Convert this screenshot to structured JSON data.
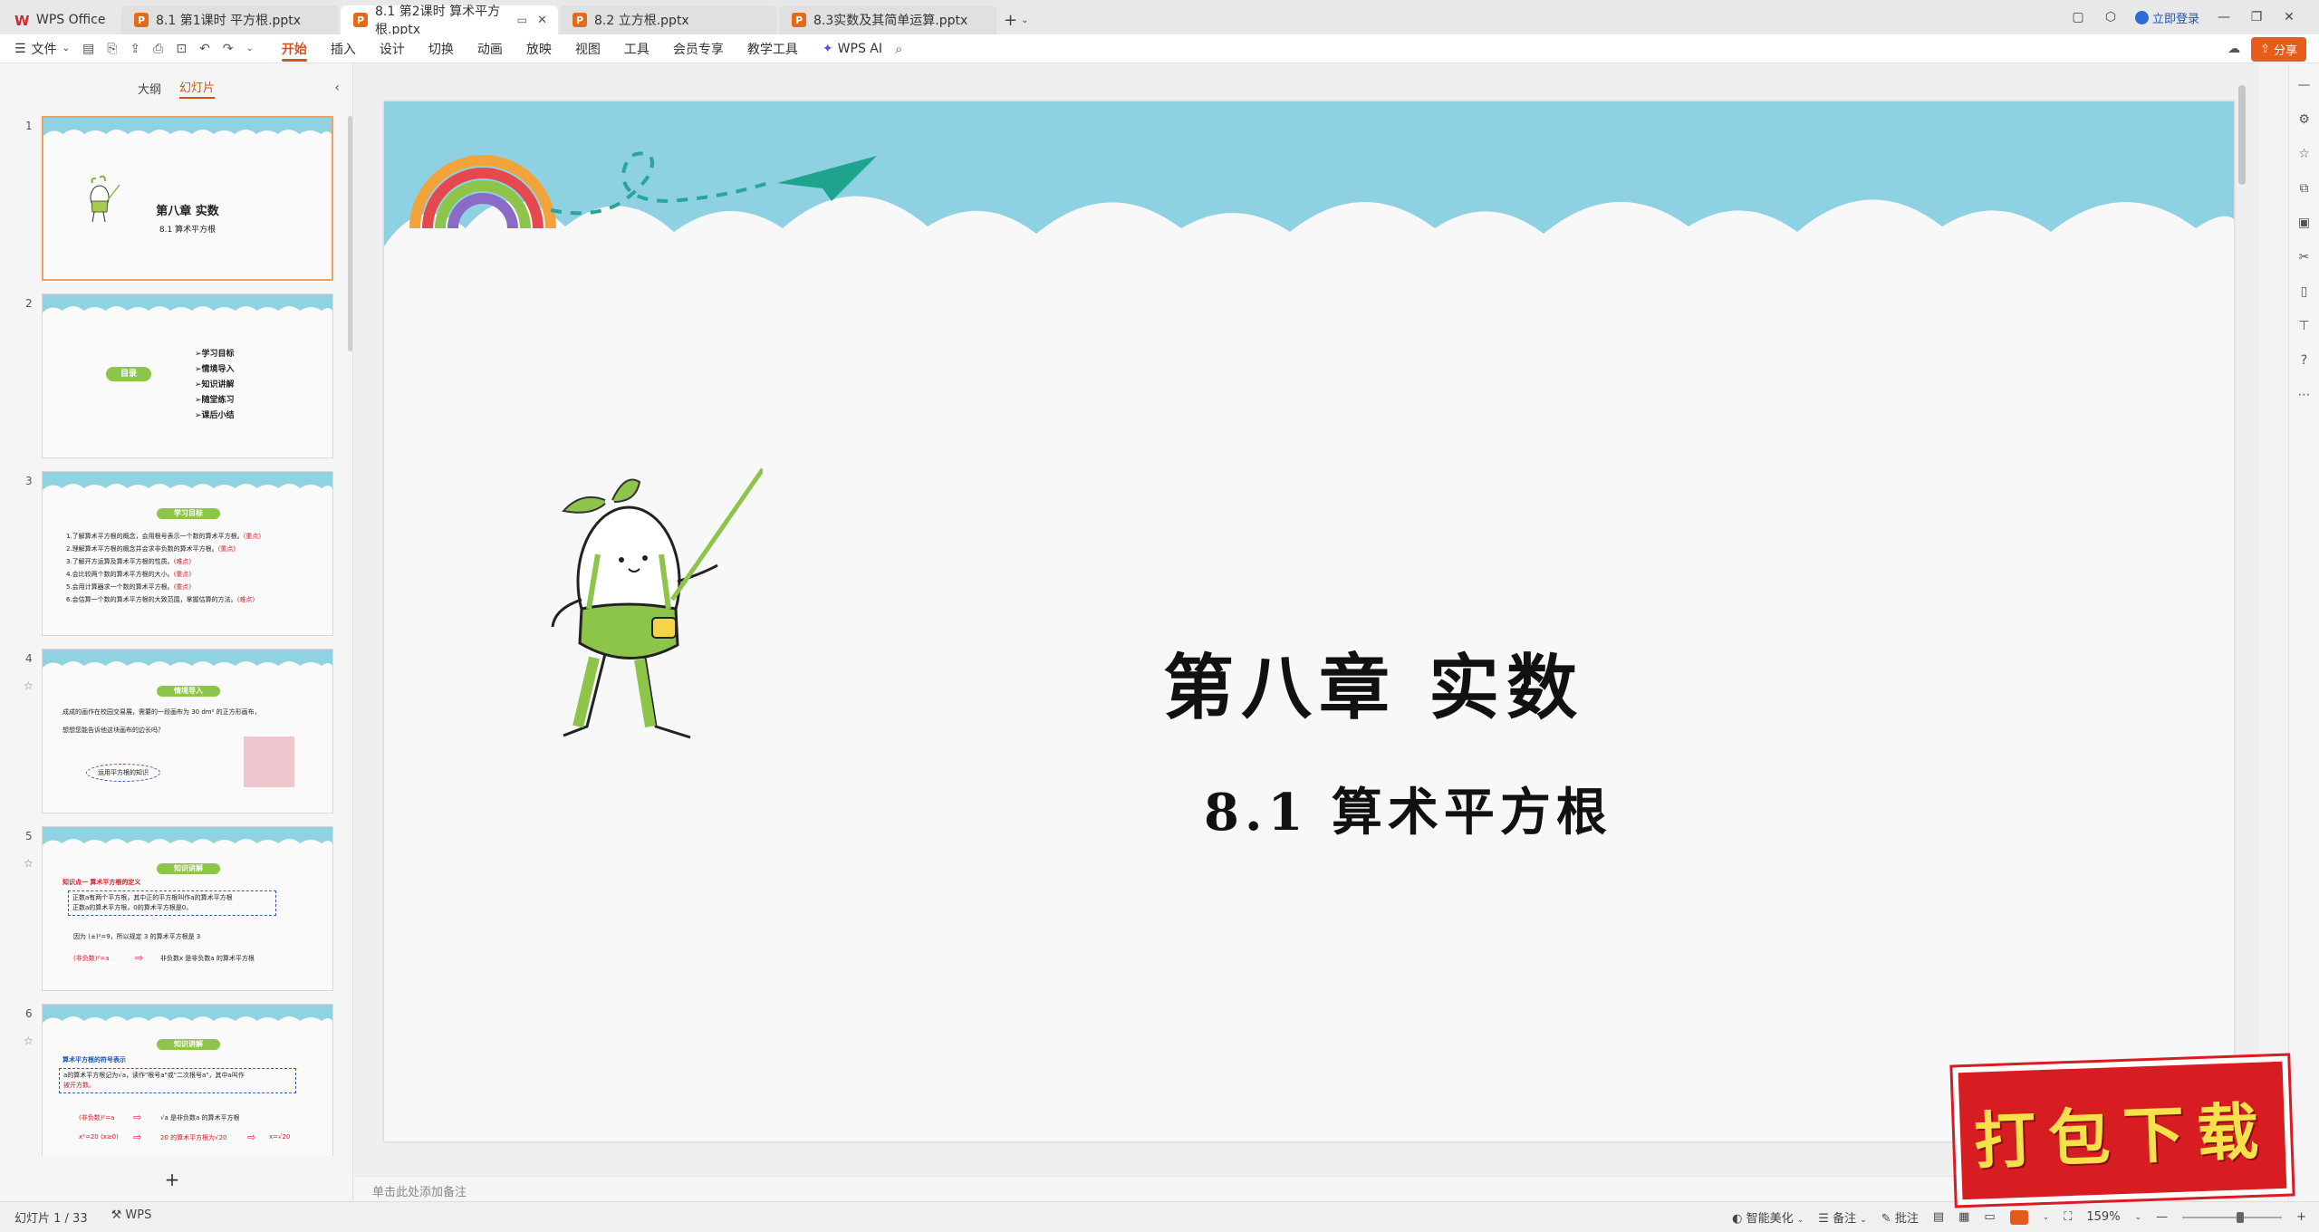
{
  "tabs": {
    "home": "WPS Office",
    "docs": [
      {
        "label": "8.1 第1课时 平方根.pptx",
        "active": false
      },
      {
        "label": "8.1 第2课时 算术平方根.pptx",
        "active": true
      },
      {
        "label": "8.2 立方根.pptx",
        "active": false
      },
      {
        "label": "8.3实数及其简单运算.pptx",
        "active": false
      }
    ],
    "add": "+",
    "login": "立即登录"
  },
  "ribbon": {
    "file": "文件",
    "menus": [
      "开始",
      "插入",
      "设计",
      "切换",
      "动画",
      "放映",
      "视图",
      "工具",
      "会员专享",
      "教学工具"
    ],
    "active_menu": "开始",
    "wps_ai": "WPS AI",
    "share": "分享"
  },
  "panel": {
    "outline_tab": "大纲",
    "slides_tab": "幻灯片",
    "add": "+"
  },
  "thumbs": {
    "s1": {
      "num": "1",
      "title": "第八章 实数",
      "sub": "8.1 算术平方根"
    },
    "s2": {
      "num": "2",
      "pill": "目录",
      "toc": [
        "➢学习目标",
        "➢情境导入",
        "➢知识讲解",
        "➢随堂练习",
        "➢课后小结"
      ]
    },
    "s3": {
      "num": "3",
      "pill": "学习目标",
      "lines": [
        "1.了解算术平方根的概念，会用根号表示一个数的算术平方根。",
        "2.理解算术平方根的概念并会求非负数的算术平方根。",
        "3.了解开方运算及算术平方根的性质。",
        "4.会比较两个数的算术平方根的大小。",
        "5.会用计算器求一个数的算术平方根。",
        "6.会估算一个数的算术平方根的大致范围，掌握估算的方法。"
      ],
      "marks": [
        "(重点)",
        "(重点)",
        "(难点)",
        "(重点)",
        "(重点)",
        "(难点)"
      ]
    },
    "s4": {
      "num": "4",
      "pill": "情境导入",
      "line1": "成成的画作在校园交易展，需要的一段画布为 30 dm² 的正方形画布，",
      "line2": "想想您能告诉他这块画布的边长吗？",
      "oval": "运用平方根的知识"
    },
    "s5": {
      "num": "5",
      "pill": "知识讲解",
      "heading": "知识点一  算术平方根的定义",
      "def1": "正数a有两个平方根，其中正的平方根叫作a的算术平方根",
      "def2": "正数a的算术平方根，0的算术平方根是0。",
      "line1": "因为 (±)²=9，所以规定 3 的算术平方根是 3",
      "left": "(非负数)²=a",
      "right": "非负数x 是非负数a 的算术平方根"
    },
    "s6": {
      "num": "6",
      "pill": "知识讲解",
      "heading": "算术平方根的符号表示",
      "box1": "a的算术平方根记为√a，读作\"根号a\"或\"二次根号a\"，其中a叫作",
      "box2": "被开方数。",
      "row1l": "(非负数)²=a",
      "row1r": "√a 是非负数a 的算术平方根",
      "row2l": "x²=20 (x≥0)",
      "row2m": "20 的算术平方根为√20",
      "row2r": "x=√20"
    }
  },
  "slide": {
    "title": "第八章  实数",
    "subtitle": "8.1  算术平方根"
  },
  "notes": {
    "placeholder": "单击此处添加备注"
  },
  "status": {
    "slide_info": "幻灯片 1 / 33",
    "app": "WPS",
    "smart": "智能美化",
    "notes_btn": "备注",
    "comment_btn": "批注",
    "zoom": "159%"
  },
  "banner": {
    "text": "打包下载"
  },
  "colors": {
    "accent": "#d1541e",
    "sky": "#8dd1e2",
    "green": "#8dc44a",
    "red": "#d0202a",
    "banner": "#d81d22"
  }
}
